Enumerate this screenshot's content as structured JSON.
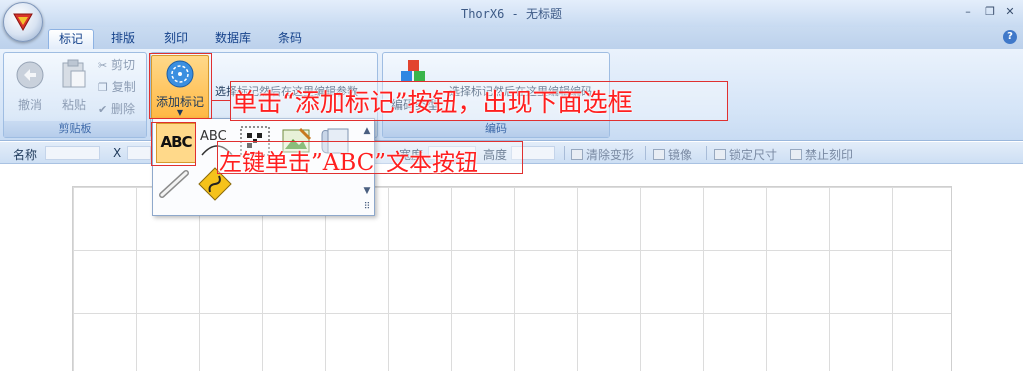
{
  "window": {
    "title": "ThorX6 - 无标题",
    "minimize": "–",
    "restore": "❐",
    "close": "✕"
  },
  "tabs": [
    {
      "label": "标记",
      "active": true
    },
    {
      "label": "排版"
    },
    {
      "label": "刻印"
    },
    {
      "label": "数据库"
    },
    {
      "label": "条码"
    }
  ],
  "help_label": "?",
  "clipboard": {
    "undo": "撤消",
    "paste": "粘贴",
    "cut": "剪切",
    "copy": "复制",
    "delete": "删除",
    "group_label": "剪贴板"
  },
  "mark_group": {
    "add_mark": "添加标记",
    "hint": "选择标记然后在这里编辑参数"
  },
  "encode_group": {
    "encode_type": "编码类型",
    "hint": "选择标记然后在这里编辑编码",
    "group_label": "编码"
  },
  "propbar": {
    "name_label": "名称",
    "x_label": "X",
    "width_label": "宽度",
    "height_label": "高度",
    "clear_transform": "清除变形",
    "mirror": "镜像",
    "lock_size": "锁定尺寸",
    "disable_engrave": "禁止刻印"
  },
  "popup": {
    "abc_text": "ABC",
    "arc_text": "ABC",
    "scroll_up": "▲",
    "scroll_down": "▼",
    "more": "⠿"
  },
  "annotations": {
    "step1": "单击“添加标记”按钮，出现下面选框",
    "step2": "左键单击”ABC”文本按钮"
  },
  "colors": {
    "accent": "#15428b",
    "annotation": "#ff1f1f"
  }
}
